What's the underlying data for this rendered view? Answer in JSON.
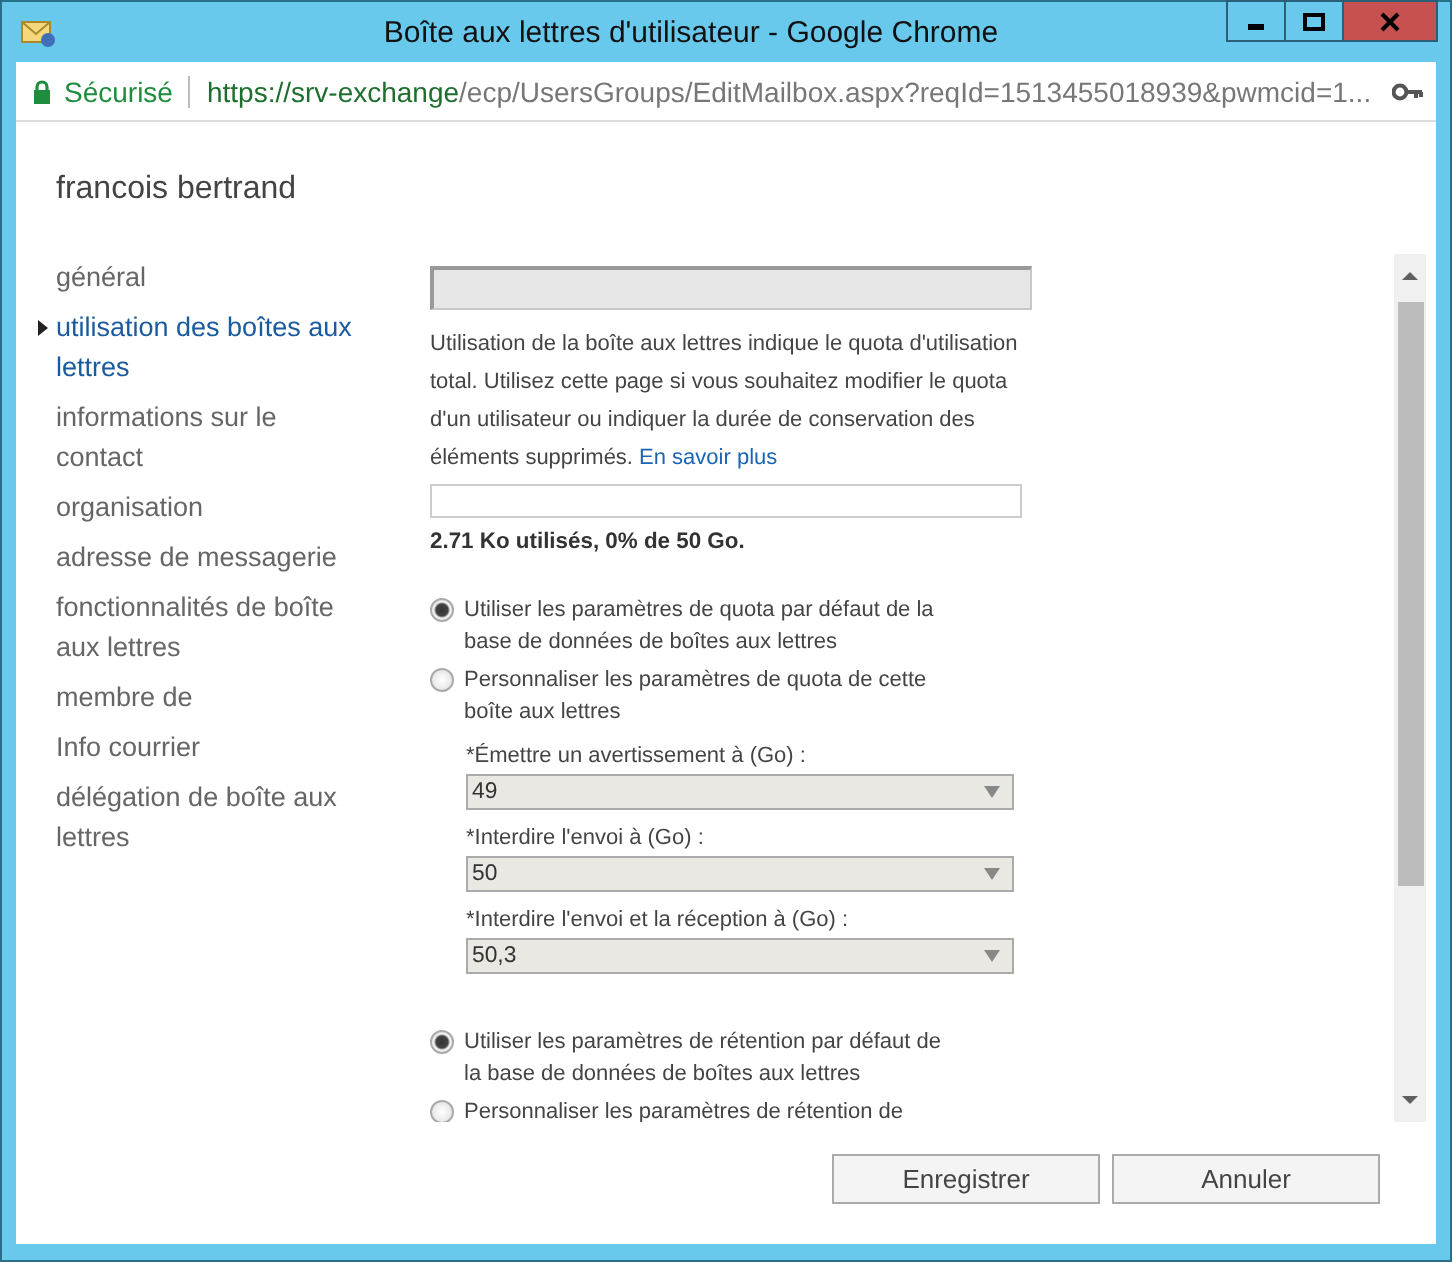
{
  "window": {
    "title": "Boîte aux lettres d'utilisateur - Google Chrome"
  },
  "address_bar": {
    "security_label": "Sécurisé",
    "url_host": "https://srv-exchange",
    "url_path": "/ecp/UsersGroups/EditMailbox.aspx?reqId=1513455018939&pwmcid=1..."
  },
  "user_name": "francois bertrand",
  "nav": [
    {
      "label": "général",
      "selected": false
    },
    {
      "label": "utilisation des boîtes aux lettres",
      "selected": true
    },
    {
      "label": "informations sur le contact",
      "selected": false
    },
    {
      "label": "organisation",
      "selected": false
    },
    {
      "label": "adresse de messagerie",
      "selected": false
    },
    {
      "label": "fonctionnalités de boîte aux lettres",
      "selected": false
    },
    {
      "label": "membre de",
      "selected": false
    },
    {
      "label": "Info courrier",
      "selected": false
    },
    {
      "label": "délégation de boîte aux lettres",
      "selected": false
    }
  ],
  "usage": {
    "description": "Utilisation de la boîte aux lettres indique le quota d'utilisation total. Utilisez cette page si vous souhaitez modifier le quota d'un utilisateur ou indiquer la durée de conservation des éléments supprimés.",
    "link": "En savoir plus",
    "level": 0,
    "summary": "2.71 Ko utilisés, 0% de 50 Go."
  },
  "quota_options": [
    {
      "label": "Utiliser les paramètres de quota par défaut de la base de données de boîtes aux lettres",
      "selected": true
    },
    {
      "label": "Personnaliser les paramètres de quota de cette boîte aux lettres",
      "selected": false
    }
  ],
  "quota_fields": [
    {
      "label": "*Émettre un avertissement à (Go) :",
      "value": "49"
    },
    {
      "label": "*Interdire l'envoi à (Go) :",
      "value": "50"
    },
    {
      "label": "*Interdire l'envoi et la réception à (Go) :",
      "value": "50,3"
    }
  ],
  "retention_options": [
    {
      "label": "Utiliser les paramètres de rétention par défaut de la base de données de boîtes aux lettres",
      "selected": true
    },
    {
      "label": "Personnaliser les paramètres de rétention de",
      "selected": false
    }
  ],
  "buttons": [
    "Enregistrer",
    "Annuler"
  ]
}
